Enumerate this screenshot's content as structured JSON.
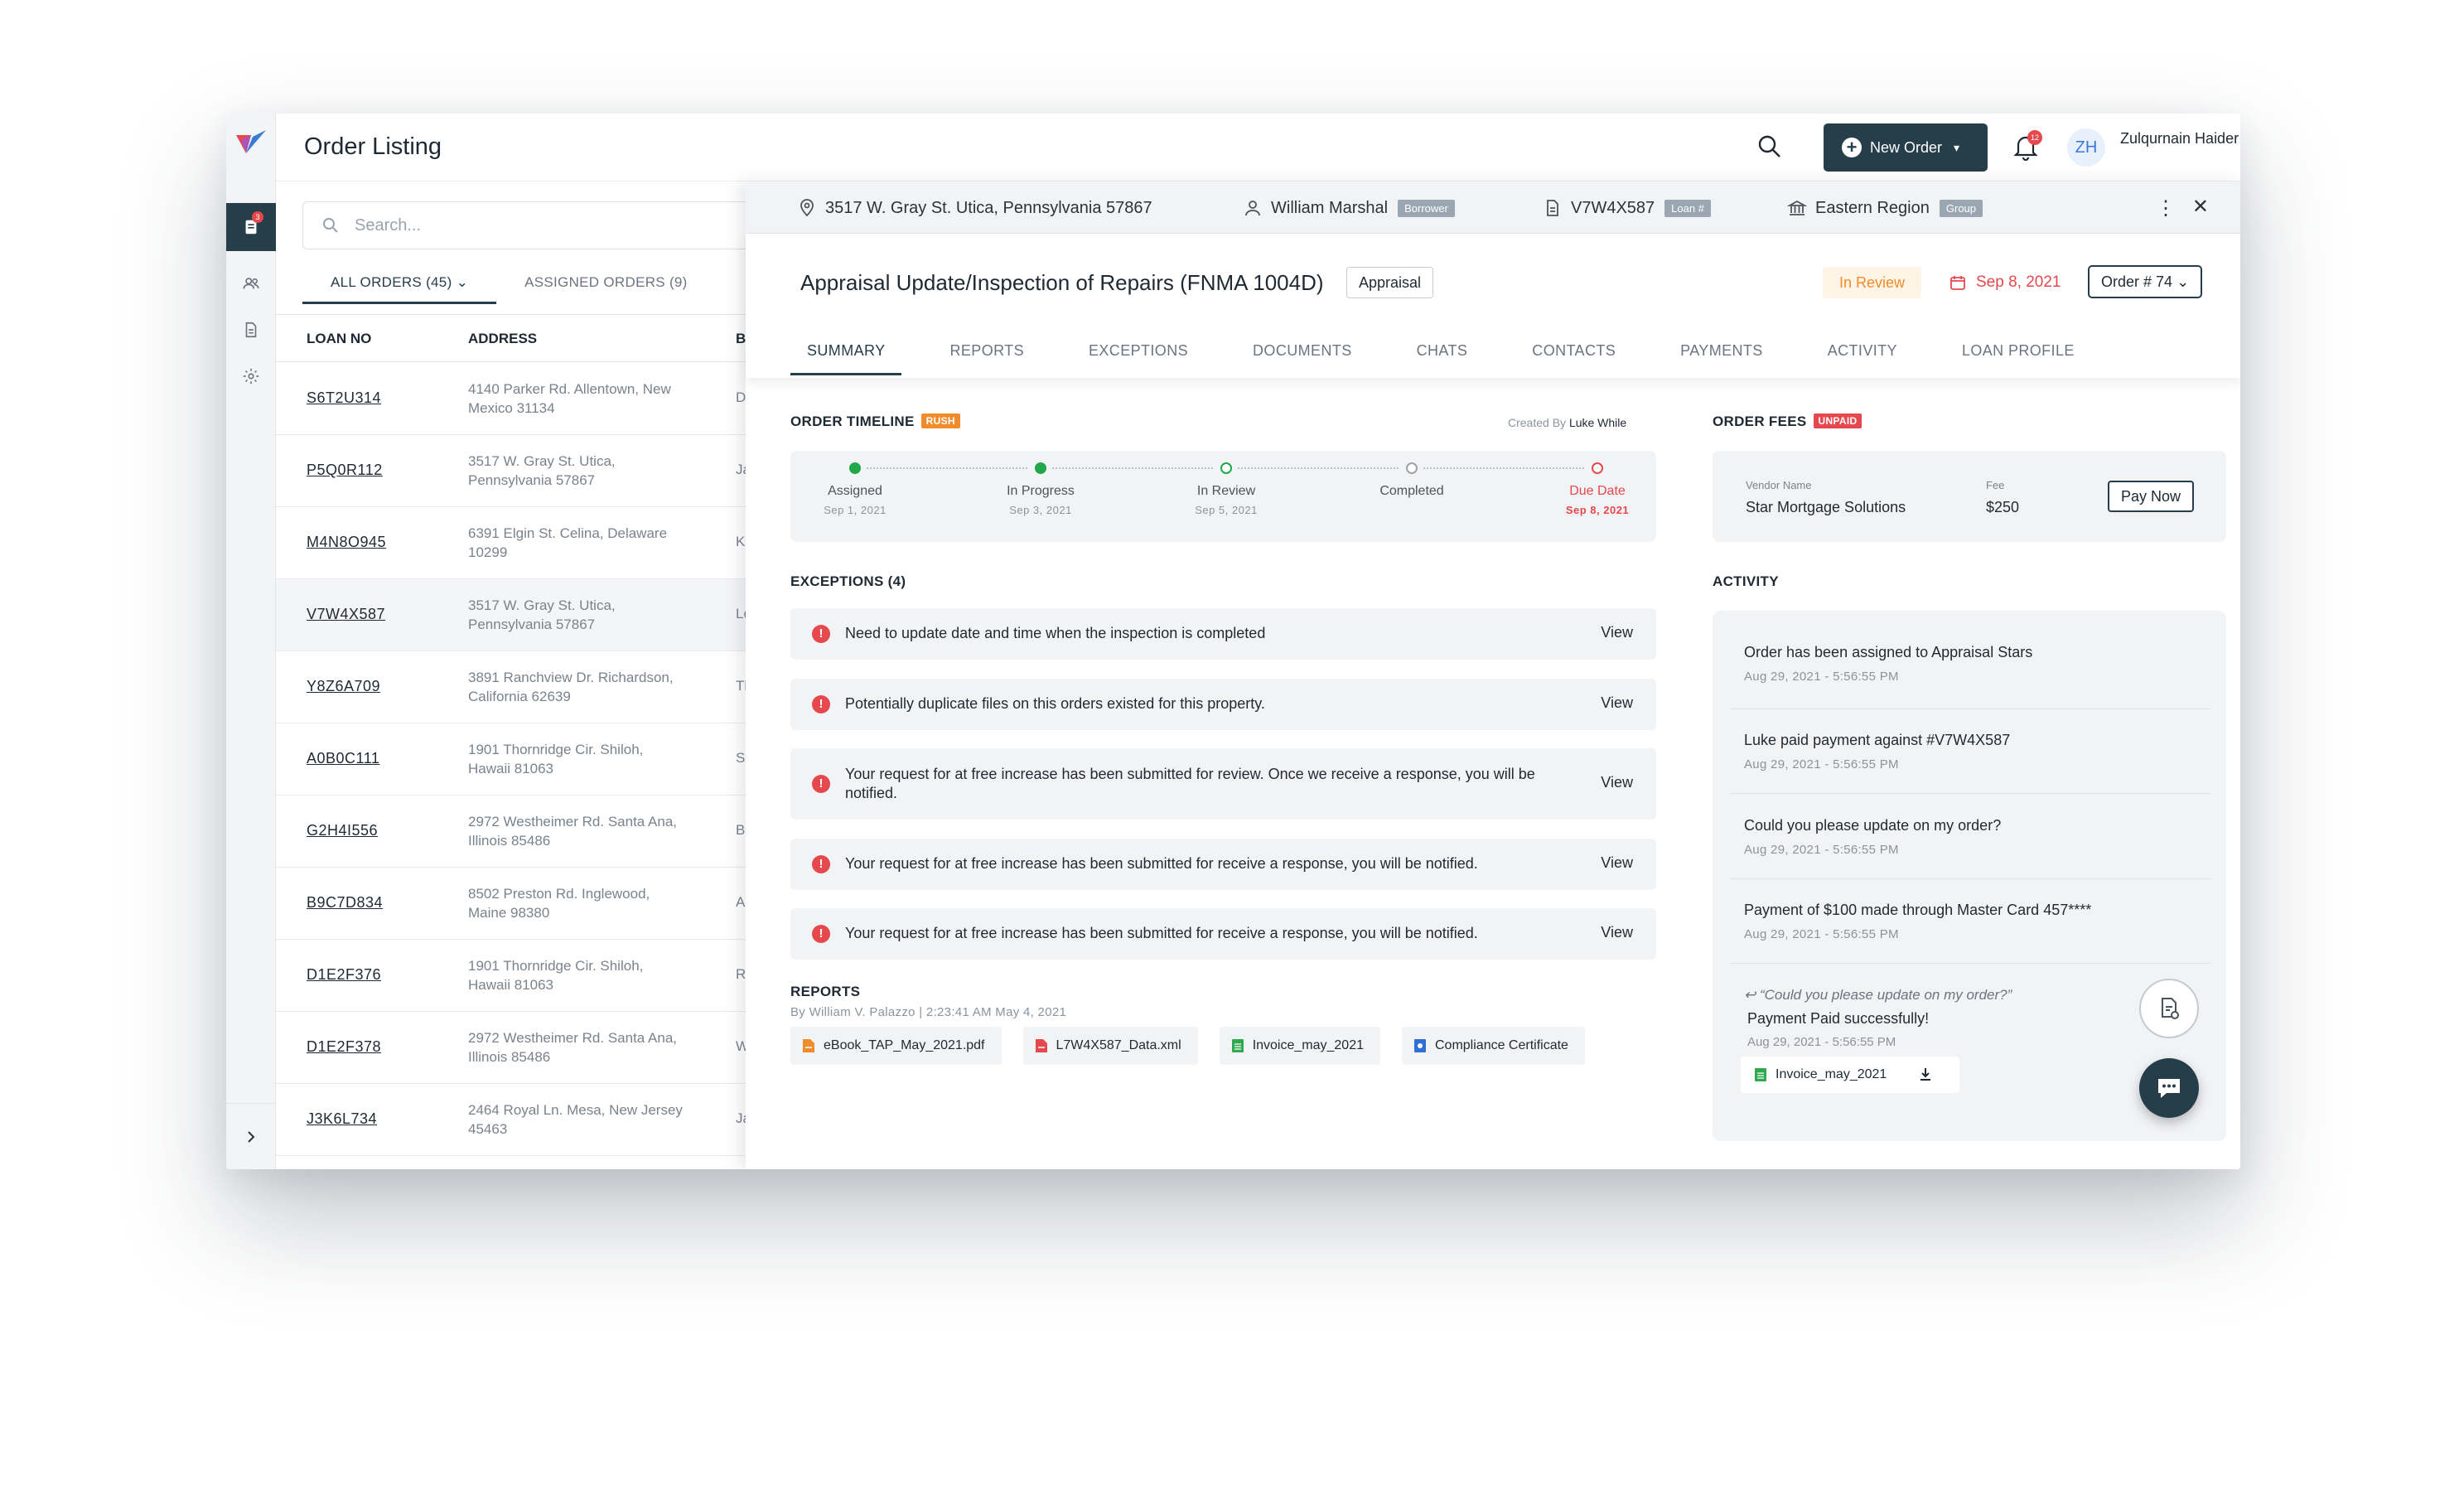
{
  "header": {
    "title": "Order Listing",
    "new_order_label": "New Order",
    "notification_count": "12",
    "user_initials": "ZH",
    "user_name": "Zulqurnain Haider"
  },
  "sidebar": {
    "badge": "3",
    "items": [
      "orders-icon",
      "users-icon",
      "document-icon",
      "settings-icon"
    ]
  },
  "list": {
    "search_placeholder": "Search...",
    "tabs": [
      {
        "label": "ALL ORDERS (45)"
      },
      {
        "label": "ASSIGNED ORDERS (9)"
      }
    ],
    "columns": {
      "loan": "LOAN NO",
      "address": "ADDRESS",
      "borrower": "BOR"
    },
    "rows": [
      {
        "loan": "S6T2U314",
        "address": "4140 Parker Rd. Allentown, New Mexico 31134",
        "borrower": "Devo"
      },
      {
        "loan": "P5Q0R112",
        "address": "3517 W. Gray St. Utica, Pennsylvania 57867",
        "borrower": "Jacc"
      },
      {
        "loan": "M4N8O945",
        "address": "6391 Elgin St. Celina, Delaware 10299",
        "borrower": "Krist"
      },
      {
        "loan": "V7W4X587",
        "address": "3517 W. Gray St. Utica, Pennsylvania 57867",
        "borrower": "Lesl"
      },
      {
        "loan": "Y8Z6A709",
        "address": "3891 Ranchview Dr. Richardson, California 62639",
        "borrower": "Ther"
      },
      {
        "loan": "A0B0C111",
        "address": "1901 Thornridge Cir. Shiloh, Hawaii 81063",
        "borrower": "Sava"
      },
      {
        "loan": "G2H4I556",
        "address": "2972 Westheimer Rd. Santa Ana, Illinois 85486",
        "borrower": "Broc"
      },
      {
        "loan": "B9C7D834",
        "address": "8502 Preston Rd. Inglewood, Maine 98380",
        "borrower": "Albe"
      },
      {
        "loan": "D1E2F376",
        "address": "1901 Thornridge Cir. Shiloh, Hawaii 81063",
        "borrower": "Robe"
      },
      {
        "loan": "D1E2F378",
        "address": "2972 Westheimer Rd. Santa Ana, Illinois 85486",
        "borrower": "Wad"
      },
      {
        "loan": "J3K6L734",
        "address": "2464 Royal Ln. Mesa, New Jersey 45463",
        "borrower": "Jane"
      }
    ]
  },
  "detail": {
    "info": {
      "address": "3517 W. Gray St. Utica, Pennsylvania 57867",
      "borrower": "William Marshal",
      "borrower_tag": "Borrower",
      "loan": "V7W4X587",
      "loan_tag": "Loan #",
      "region": "Eastern Region",
      "region_tag": "Group"
    },
    "title": "Appraisal Update/Inspection of Repairs (FNMA 1004D)",
    "type": "Appraisal",
    "status": "In Review",
    "due": "Sep 8, 2021",
    "order_number": "Order # 74",
    "tabs": [
      "SUMMARY",
      "REPORTS",
      "EXCEPTIONS",
      "DOCUMENTS",
      "CHATS",
      "CONTACTS",
      "PAYMENTS",
      "ACTIVITY",
      "LOAN PROFILE"
    ],
    "timeline": {
      "title": "ORDER TIMELINE",
      "tag": "RUSH",
      "created_prefix": "Created By",
      "created_by": "Luke While",
      "steps": [
        {
          "label": "Assigned",
          "date": "Sep 1, 2021",
          "state": "done"
        },
        {
          "label": "In Progress",
          "date": "Sep 3, 2021",
          "state": "done"
        },
        {
          "label": "In Review",
          "date": "Sep 5, 2021",
          "state": "current"
        },
        {
          "label": "Completed",
          "date": "",
          "state": "pending"
        },
        {
          "label": "Due Date",
          "date": "Sep 8, 2021",
          "state": "due"
        }
      ]
    },
    "fees": {
      "title": "ORDER FEES",
      "tag": "UNPAID",
      "vendor_label": "Vendor Name",
      "vendor": "Star Mortgage Solutions",
      "fee_label": "Fee",
      "fee": "$250",
      "pay_label": "Pay Now"
    },
    "exceptions": {
      "title": "EXCEPTIONS (4)",
      "view_label": "View",
      "items": [
        "Need to update date and time when the inspection is completed",
        "Potentially duplicate files on this orders existed for this property.",
        "Your request for at free increase has been submitted for review. Once we receive a response, you will be notified.",
        "Your request for at free increase has been submitted for receive a response, you will be notified.",
        "Your request for at free increase has been submitted for receive a response, you will be notified."
      ]
    },
    "reports": {
      "title": "REPORTS",
      "by": "By William V. Palazzo | 2:23:41 AM May 4, 2021",
      "files": [
        {
          "name": "eBook_TAP_May_2021.pdf",
          "color": "#f08c2c"
        },
        {
          "name": "L7W4X587_Data.xml",
          "color": "#e5484d"
        },
        {
          "name": "Invoice_may_2021",
          "color": "#2fa84f"
        },
        {
          "name": "Compliance Certificate",
          "color": "#2f6fd6"
        }
      ]
    },
    "activity": {
      "title": "ACTIVITY",
      "items": [
        {
          "text": "Order has been assigned to Appraisal Stars",
          "date": "Aug 29, 2021 - 5:56:55 PM"
        },
        {
          "text": "Luke paid payment against #V7W4X587",
          "date": "Aug 29, 2021 - 5:56:55 PM"
        },
        {
          "text": "Could you please update on my order?",
          "date": "Aug 29, 2021 - 5:56:55 PM"
        },
        {
          "text": "Payment of $100 made through Master Card 457****",
          "date": "Aug 29, 2021 - 5:56:55 PM"
        }
      ],
      "reply_quote": "“Could you please update on my order?”",
      "reply_text": "Payment Paid successfully!",
      "reply_date": "Aug 29, 2021 - 5:56:55 PM",
      "attachment": "Invoice_may_2021"
    }
  }
}
